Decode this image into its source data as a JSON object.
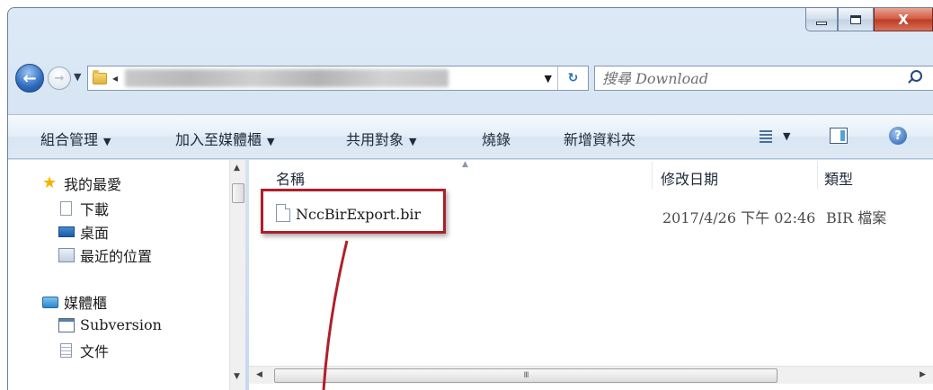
{
  "window": {
    "close_glyph": "X"
  },
  "address": {
    "dropdown_glyph": "▼",
    "refresh_glyph": "↻"
  },
  "search": {
    "placeholder": "搜尋 Download"
  },
  "command_bar": {
    "organize": "組合管理",
    "add_to_library": "加入至媒體櫃",
    "share_with": "共用對象",
    "burn": "燒錄",
    "new_folder": "新增資料夾",
    "dropdown_glyph": "▼",
    "help_glyph": "?"
  },
  "navigation": {
    "favorites": "我的最愛",
    "downloads": "下載",
    "desktop": "桌面",
    "recent_places": "最近的位置",
    "libraries": "媒體櫃",
    "subversion": "Subversion",
    "documents": "文件"
  },
  "columns": {
    "name": "名稱",
    "date_modified": "修改日期",
    "type": "類型"
  },
  "files": [
    {
      "name": "NccBirExport.bir",
      "date_modified": "2017/4/26 下午 02:46",
      "type": "BIR 檔案"
    }
  ],
  "scrollbar": {
    "grip": "III"
  },
  "colors": {
    "highlight": "#b01e2a",
    "chrome": "#cfe0f2",
    "close_button": "#c03a22"
  },
  "icons": {
    "back": "back-arrow-icon",
    "forward": "forward-arrow-icon",
    "favorites": "star-icon",
    "search": "search-icon",
    "help": "help-icon"
  }
}
